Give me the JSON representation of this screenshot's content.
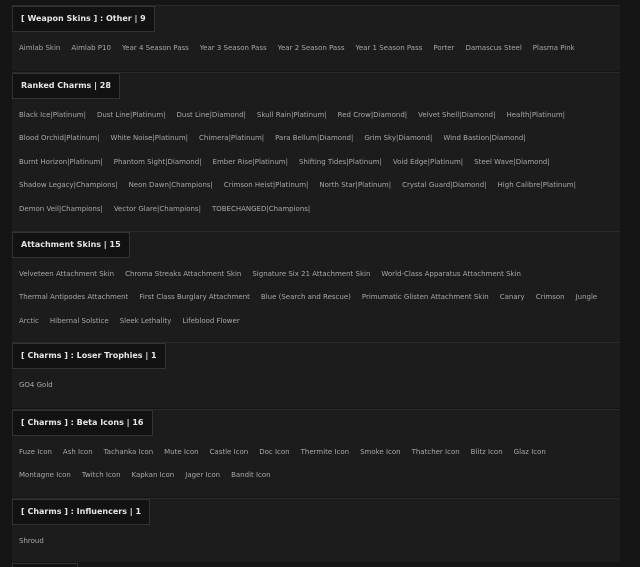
{
  "sections": [
    {
      "title": "[ Weapon Skins ] : Other | 9",
      "items": [
        "Aimlab Skin",
        "Aimlab P10",
        "Year 4 Season Pass",
        "Year 3 Season Pass",
        "Year 2 Season Pass",
        "Year 1 Season Pass",
        "Porter",
        "Damascus Steel",
        "Plasma Pink"
      ]
    },
    {
      "title": "Ranked Charms | 28",
      "items": [
        "Black Ice|Platinum|",
        "Dust Line|Platinum|",
        "Dust Line|Diamond|",
        "Skull Rain|Platinum|",
        "Red Crow|Diamond|",
        "Velvet Shell|Diamond|",
        "Health|Platinum|",
        "Blood Orchid|Platinum|",
        "White Noise|Platinum|",
        "Chimera|Platinum|",
        "Para Bellum|Diamond|",
        "Grim Sky|Diamond|",
        "Wind Bastion|Diamond|",
        "Burnt Horizon|Platinum|",
        "Phantom Sight|Diamond|",
        "Ember Rise|Platinum|",
        "Shifting Tides|Platinum|",
        "Void Edge|Platinum|",
        "Steel Wave|Diamond|",
        "Shadow Legacy|Champions|",
        "Neon Dawn|Champions|",
        "Crimson Heist|Platinum|",
        "North Star|Platinum|",
        "Crystal Guard|Diamond|",
        "High Calibre|Platinum|",
        "Demon Veil|Champions|",
        "Vector Glare|Champions|",
        "TOBECHANGED|Champions|"
      ]
    },
    {
      "title": "Attachment Skins | 15",
      "items": [
        "Velveteen Attachment Skin",
        "Chroma Streaks Attachment Skin",
        "Signature Six 21 Attachment Skin",
        "World-Class Apparatus Attachment Skin",
        "Thermal Antipodes Attachment",
        "First Class Burglary Attachment",
        "Blue (Search and Rescue)",
        "Primumatic Glisten Attachment Skin",
        "Canary",
        "Crimson",
        "Jungle",
        "Arctic",
        "Hibernal Solstice",
        "Sleek Lethality",
        "Lifeblood Flower"
      ]
    },
    {
      "title": "[ Charms ] : Loser Trophies | 1",
      "items": [
        "GO4 Gold"
      ]
    },
    {
      "title": "[ Charms ] : Beta Icons | 16",
      "items": [
        "Fuze Icon",
        "Ash Icon",
        "Tachanka Icon",
        "Mute Icon",
        "Castle Icon",
        "Doc Icon",
        "Thermite Icon",
        "Smoke Icon",
        "Thatcher Icon",
        "Blitz Icon",
        "Glaz Icon",
        "Montagne Icon",
        "Twitch Icon",
        "Kapkan Icon",
        "Jager Icon",
        "Bandit Icon"
      ]
    },
    {
      "title": "[ Charms ] : Influencers | 1",
      "items": [
        "Shroud"
      ]
    }
  ]
}
